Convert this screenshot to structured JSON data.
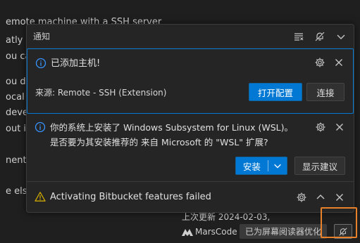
{
  "background": {
    "lines": [
      "emote machine with a SSH server",
      "atly s",
      "ou ca",
      "ou de",
      "ocal",
      "devel",
      "out i",
      "nent",
      "e else"
    ],
    "bottom_fragment": "上次更新 2024-02-03,"
  },
  "notification_center": {
    "title": "通知",
    "header_icons": [
      "clear-all-icon",
      "do-not-disturb-icon",
      "chevron-down-icon"
    ]
  },
  "notifications": [
    {
      "severity": "info",
      "icon": "info-icon",
      "message": "已添加主机!",
      "source": "来源: Remote - SSH (Extension)",
      "actions": [
        {
          "label": "打开配置",
          "kind": "primary"
        },
        {
          "label": "连接",
          "kind": "secondary"
        }
      ]
    },
    {
      "severity": "info",
      "icon": "info-icon",
      "message": "你的系统上安装了 Windows Subsystem for Linux (WSL)。是否要为其安装推荐的 来自 Microsoft 的 \"WSL\" 扩展?",
      "actions": [
        {
          "label": "安装",
          "kind": "primary"
        },
        {
          "label": "显示建议",
          "kind": "secondary"
        }
      ]
    },
    {
      "severity": "warning",
      "icon": "warning-icon",
      "message": "Activating Bitbucket features failed"
    }
  ],
  "statusbar": {
    "marscode_label": "MarsCode",
    "screen_reader_label": "已为屏幕阅读器优化",
    "bell_icon": "bell-slash-icon"
  },
  "colors": {
    "accent": "#0078d4",
    "warning": "#cca700",
    "highlight": "#e8822a"
  }
}
